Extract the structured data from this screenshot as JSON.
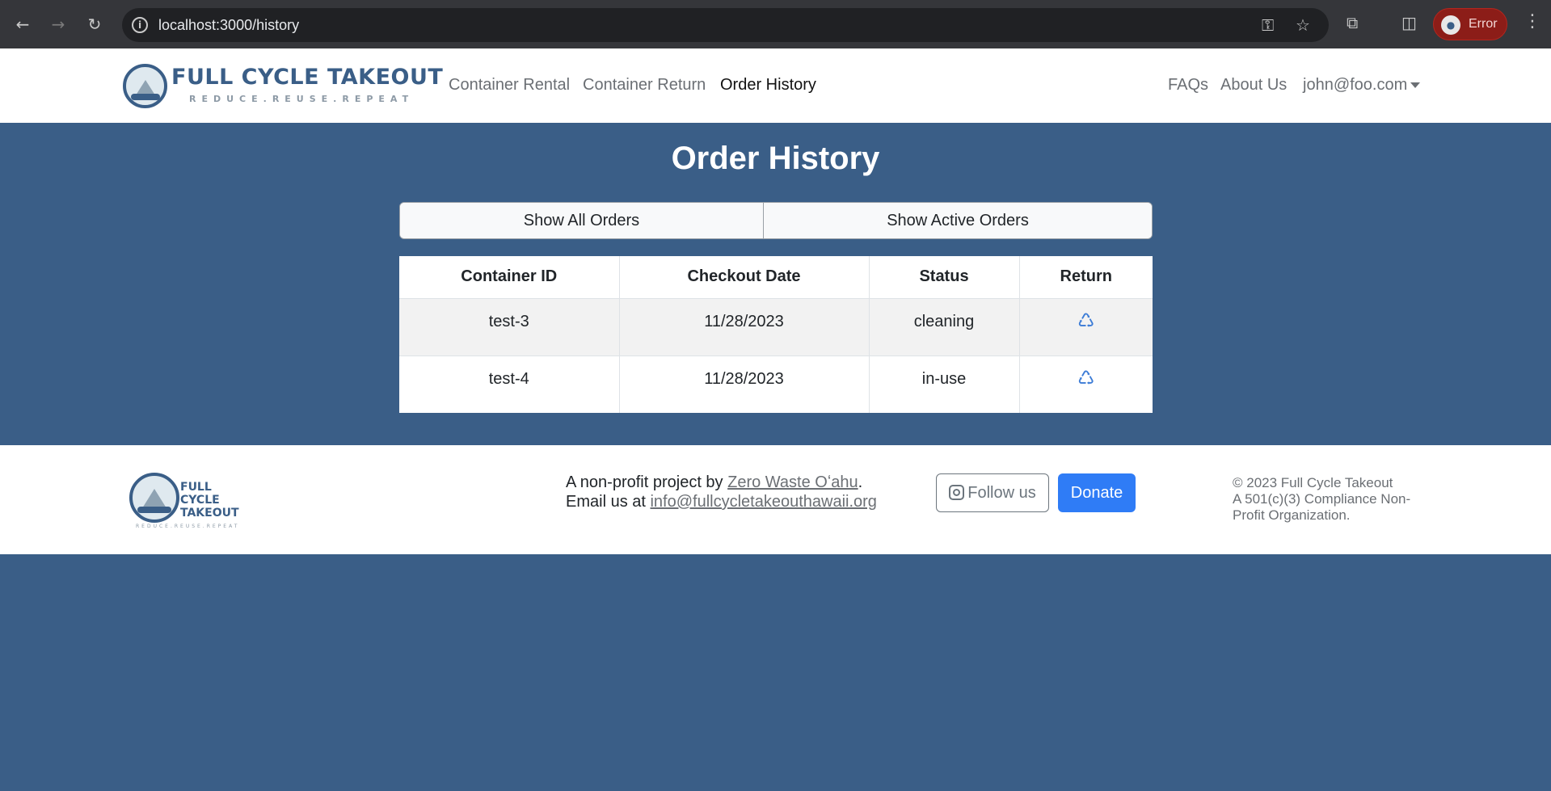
{
  "browser": {
    "url": "localhost:3000/history",
    "profile_label": "Error"
  },
  "brand": {
    "name": "FULL CYCLE TAKEOUT",
    "tagline": "REDUCE.REUSE.REPEAT",
    "footer_name_lines": [
      "FULL",
      "CYCLE",
      "TAKEOUT"
    ]
  },
  "nav": {
    "links": [
      "Container Rental",
      "Container Return",
      "Order History"
    ],
    "active": "Order History",
    "right_links": [
      "FAQs",
      "About Us"
    ],
    "user_email": "john@foo.com"
  },
  "main": {
    "title": "Order History",
    "filter_buttons": [
      "Show All Orders",
      "Show Active Orders"
    ],
    "table": {
      "headers": [
        "Container ID",
        "Checkout Date",
        "Status",
        "Return"
      ],
      "rows": [
        {
          "container_id": "test-3",
          "checkout_date": "11/28/2023",
          "status": "cleaning",
          "return_icon": "recycle-icon"
        },
        {
          "container_id": "test-4",
          "checkout_date": "11/28/2023",
          "status": "in-use",
          "return_icon": "recycle-icon"
        }
      ]
    }
  },
  "footer": {
    "project_prefix": "A non-profit project by ",
    "project_link": "Zero Waste Oʻahu",
    "project_suffix": ".",
    "email_prefix": "Email us at ",
    "email": "info@fullcycletakeouthawaii.org",
    "follow_label": "Follow us",
    "donate_label": "Donate",
    "copyright": "© 2023 Full Cycle Takeout",
    "compliance": "A 501(c)(3) Compliance Non-Profit Organization."
  },
  "colors": {
    "page_bg": "#3a5e87",
    "brand_blue": "#3a5e87",
    "donate_blue": "#2f7cf6",
    "recycle_icon": "#3b7bd6"
  }
}
